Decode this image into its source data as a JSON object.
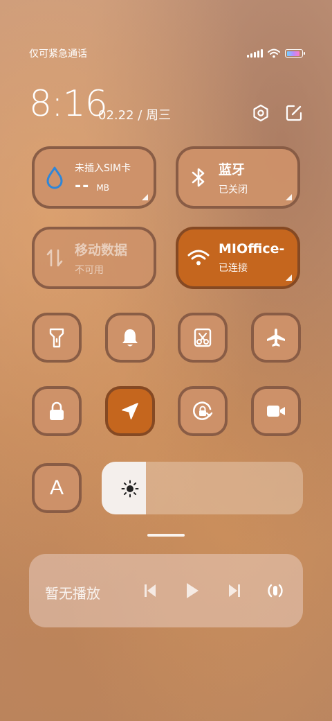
{
  "status_bar": {
    "carrier": "仅可紧急通话"
  },
  "header": {
    "time": "8:16",
    "date": "02.22",
    "separator": "/",
    "weekday": "周三"
  },
  "tiles": {
    "data_usage": {
      "title": "未插入SIM卡",
      "value": "--",
      "unit": "MB"
    },
    "bluetooth": {
      "title": "蓝牙",
      "status": "已关闭"
    },
    "mobile_data": {
      "title": "移动数据",
      "status": "不可用"
    },
    "wifi": {
      "title": "MIOffice-",
      "status": "已连接"
    }
  },
  "toggles": [
    {
      "name": "flashlight",
      "active": false
    },
    {
      "name": "mute",
      "active": false
    },
    {
      "name": "screenshot",
      "active": false
    },
    {
      "name": "airplane-mode",
      "active": false
    },
    {
      "name": "lock-screen",
      "active": false
    },
    {
      "name": "location",
      "active": true
    },
    {
      "name": "rotation-lock",
      "active": false
    },
    {
      "name": "screen-recorder",
      "active": false
    }
  ],
  "reading_mode": {
    "icon": "A"
  },
  "brightness": {
    "level": 0.22
  },
  "media": {
    "title": "暂无播放"
  },
  "colors": {
    "accent": "#c5661e",
    "tile": "#cd9169"
  }
}
